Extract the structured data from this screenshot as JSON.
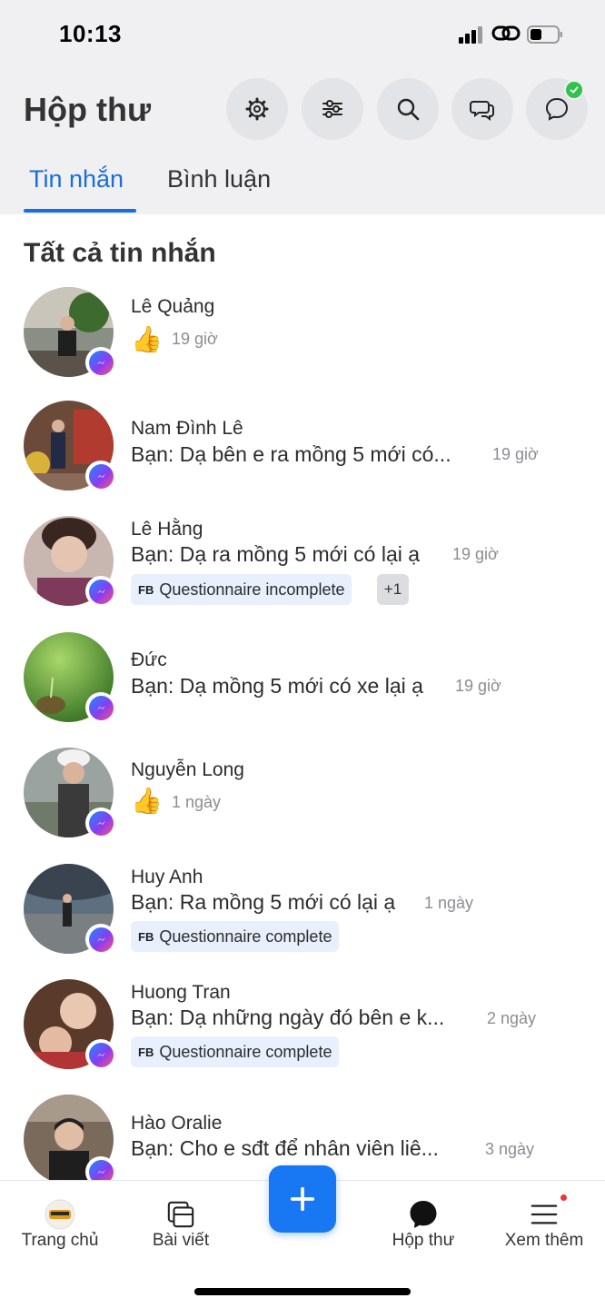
{
  "status_bar": {
    "time": "10:13"
  },
  "header": {
    "title": "Hộp thư",
    "buttons": [
      "settings-icon",
      "filter-icon",
      "search-icon",
      "comments-icon",
      "messenger-check-icon"
    ]
  },
  "tabs": [
    {
      "label": "Tin nhắn",
      "active": true
    },
    {
      "label": "Bình luận",
      "active": false
    }
  ],
  "section_title": "Tất cả tin nhắn",
  "conversations": [
    {
      "name": "Lê Quảng",
      "preview": "",
      "like": "👍",
      "time": "19 giờ"
    },
    {
      "name": "Nam Đình Lê",
      "preview": "Bạn: Dạ bên e ra mồng 5 mới có...",
      "time": "19 giờ"
    },
    {
      "name": "Lê Hằng",
      "preview": "Bạn: Dạ ra mồng 5 mới có lại ạ",
      "time": "19 giờ",
      "tag": "Questionnaire incomplete",
      "tag_prefix": "FB",
      "extra": "+1"
    },
    {
      "name": "Đức",
      "preview": "Bạn: Dạ mồng 5 mới có xe lại ạ",
      "time": "19 giờ"
    },
    {
      "name": "Nguyễn Long",
      "preview": "",
      "like": "👍",
      "time": "1 ngày"
    },
    {
      "name": "Huy Anh",
      "preview": "Bạn: Ra mồng 5 mới có lại ạ",
      "time": "1 ngày",
      "tag": "Questionnaire complete",
      "tag_prefix": "FB"
    },
    {
      "name": "Huong Tran",
      "preview": "Bạn: Dạ những ngày đó bên e k...",
      "time": "2 ngày",
      "tag": "Questionnaire complete",
      "tag_prefix": "FB"
    },
    {
      "name": "Hào Oralie",
      "preview": "Bạn: Cho e sđt để nhân viên liê...",
      "time": "3 ngày"
    }
  ],
  "bottom_nav": [
    {
      "label": "Trang chủ",
      "icon": "page-avatar-icon"
    },
    {
      "label": "Bài viết",
      "icon": "posts-icon"
    },
    {
      "label": "",
      "icon": "plus-icon"
    },
    {
      "label": "Hộp thư",
      "icon": "inbox-chat-icon"
    },
    {
      "label": "Xem thêm",
      "icon": "menu-icon"
    }
  ],
  "colors": {
    "accent": "#1a6ed8",
    "fab": "#1877f2",
    "header_bg": "#f0f0f2",
    "tag_bg": "#e7f0fc",
    "badge_green": "#31c24d"
  }
}
